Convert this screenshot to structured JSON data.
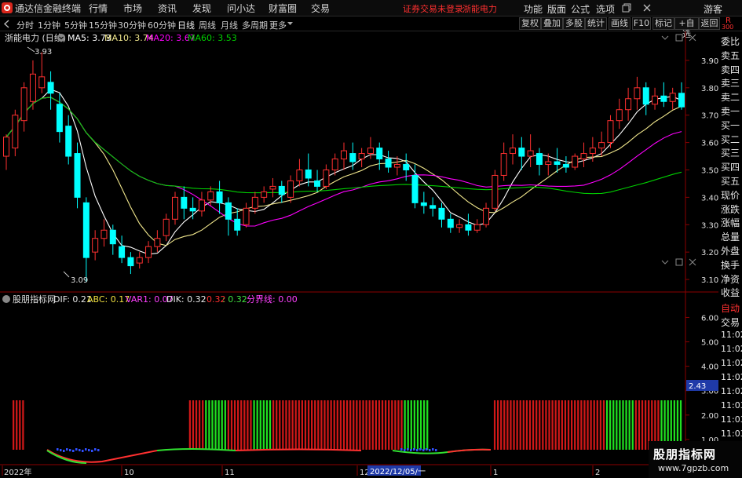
{
  "app": {
    "title": "通达信金融终端"
  },
  "menu": [
    {
      "label": "行情"
    },
    {
      "label": "市场"
    },
    {
      "label": "资讯"
    },
    {
      "label": "发现"
    },
    {
      "label": "问小达"
    },
    {
      "label": "财富圈"
    },
    {
      "label": "交易"
    }
  ],
  "status_text": "证券交易未登录",
  "stock_name": "浙能电力",
  "right_menu": [
    {
      "label": "功能"
    },
    {
      "label": "版面"
    },
    {
      "label": "公式"
    },
    {
      "label": "选项"
    }
  ],
  "guest_label": "游客",
  "periods": [
    {
      "label": "分时"
    },
    {
      "label": "1分钟"
    },
    {
      "label": "5分钟"
    },
    {
      "label": "15分钟"
    },
    {
      "label": "30分钟"
    },
    {
      "label": "60分钟"
    },
    {
      "label": "日线"
    },
    {
      "label": "周线"
    },
    {
      "label": "月线"
    },
    {
      "label": "多周期"
    },
    {
      "label": "更多"
    }
  ],
  "tool_buttons": [
    {
      "label": "复权"
    },
    {
      "label": "叠加"
    },
    {
      "label": "多股"
    },
    {
      "label": "统计"
    },
    {
      "label": "画线"
    },
    {
      "label": "F10"
    },
    {
      "label": "标记"
    },
    {
      "label": "+自选"
    },
    {
      "label": "返回"
    }
  ],
  "corner": {
    "top": "R",
    "bottom": "300"
  },
  "main_chart": {
    "title": "浙能电力 (日线)",
    "ma": [
      {
        "label": "MA5: 3.73",
        "color": "#ffffff"
      },
      {
        "label": "MA10: 3.74",
        "color": "#f0e68c"
      },
      {
        "label": "MA20: 3.67",
        "color": "#ff00ff"
      },
      {
        "label": "MA60: 3.53",
        "color": "#00d000"
      }
    ],
    "high_marker": "3.93",
    "low_marker": "3.09",
    "y_ticks": [
      "3.90",
      "3.80",
      "3.70",
      "3.60",
      "3.50",
      "3.40",
      "3.30",
      "3.20",
      "3.10"
    ]
  },
  "sub_chart": {
    "title": "股朋指标网",
    "items": [
      {
        "label": "DIF: 0.21",
        "color": "#e8e8e8"
      },
      {
        "label": "ABC: 0.17",
        "color": "#f0e040"
      },
      {
        "label": "VAR1: 0.07",
        "color": "#ff40ff"
      },
      {
        "label": "DIK: 0.32",
        "color": "#e8e8e8"
      },
      {
        "label": "0.32",
        "color": "#ff3030"
      },
      {
        "label": ": 0.32",
        "color": "#40e040"
      },
      {
        "label": "分界线: 0.00",
        "color": "#ff40ff"
      }
    ],
    "y_ticks": [
      "6.00",
      "5.00",
      "4.00",
      "3.00",
      "2.00",
      "1.00"
    ],
    "current_value": "2.43"
  },
  "x_axis": {
    "labels": [
      "2022年",
      "10",
      "11",
      "12",
      "1",
      "2"
    ],
    "cursor_label": "2022/12/05/一"
  },
  "right_panel": [
    {
      "label": "委比"
    },
    {
      "label": "卖五"
    },
    {
      "label": "卖四"
    },
    {
      "label": "卖三"
    },
    {
      "label": "卖二"
    },
    {
      "label": "卖一"
    },
    {
      "label": "买一"
    },
    {
      "label": "买二"
    },
    {
      "label": "买三"
    },
    {
      "label": "买四"
    },
    {
      "label": "买五"
    },
    {
      "label": "现价"
    },
    {
      "label": "涨跌"
    },
    {
      "label": "涨幅"
    },
    {
      "label": "总量"
    },
    {
      "label": "外盘"
    },
    {
      "label": "换手"
    },
    {
      "label": "净资"
    },
    {
      "label": "收益"
    },
    {
      "label": "自动"
    },
    {
      "label": "交易"
    },
    {
      "label": "11:02"
    },
    {
      "label": "11:02"
    },
    {
      "label": "11:02"
    },
    {
      "label": "11:02"
    },
    {
      "label": "11:02"
    },
    {
      "label": "11:03"
    },
    {
      "label": "11:03"
    },
    {
      "label": "11:03"
    },
    {
      "label": "11:03"
    },
    {
      "label": "11:03"
    },
    {
      "label": "11:03"
    },
    {
      "label": "11:03"
    }
  ],
  "watermark": {
    "line1": "股朋指标网",
    "line2": "www.7gpzb.com"
  },
  "colors": {
    "up": "#ff3030",
    "down": "#00ffff",
    "grid": "#8b0000",
    "ma5": "#ffffff",
    "ma10": "#f0e68c",
    "ma20": "#ff00ff",
    "ma60": "#00d000"
  },
  "chart_data": {
    "type": "candlestick",
    "title": "浙能电力 (日线)",
    "y_range": [
      3.06,
      3.96
    ],
    "candles": [
      [
        3.55,
        3.63,
        3.62,
        3.5
      ],
      [
        3.58,
        3.72,
        3.7,
        3.55
      ],
      [
        3.68,
        3.82,
        3.8,
        3.64
      ],
      [
        3.75,
        3.9,
        3.85,
        3.72
      ],
      [
        3.8,
        3.93,
        3.84,
        3.78
      ],
      [
        3.82,
        3.86,
        3.78,
        3.72
      ],
      [
        3.74,
        3.78,
        3.64,
        3.6
      ],
      [
        3.66,
        3.7,
        3.55,
        3.52
      ],
      [
        3.56,
        3.6,
        3.4,
        3.36
      ],
      [
        3.38,
        3.4,
        3.18,
        3.09
      ],
      [
        3.2,
        3.28,
        3.25,
        3.17
      ],
      [
        3.25,
        3.32,
        3.28,
        3.22
      ],
      [
        3.28,
        3.3,
        3.23,
        3.19
      ],
      [
        3.22,
        3.26,
        3.18,
        3.16
      ],
      [
        3.18,
        3.2,
        3.15,
        3.12
      ],
      [
        3.16,
        3.2,
        3.18,
        3.14
      ],
      [
        3.18,
        3.24,
        3.22,
        3.16
      ],
      [
        3.22,
        3.28,
        3.25,
        3.2
      ],
      [
        3.26,
        3.34,
        3.32,
        3.24
      ],
      [
        3.32,
        3.42,
        3.4,
        3.3
      ],
      [
        3.4,
        3.44,
        3.36,
        3.32
      ],
      [
        3.36,
        3.4,
        3.35,
        3.32
      ],
      [
        3.35,
        3.42,
        3.39,
        3.33
      ],
      [
        3.39,
        3.44,
        3.42,
        3.37
      ],
      [
        3.42,
        3.46,
        3.38,
        3.34
      ],
      [
        3.38,
        3.4,
        3.32,
        3.26
      ],
      [
        3.32,
        3.36,
        3.28,
        3.26
      ],
      [
        3.3,
        3.38,
        3.36,
        3.29
      ],
      [
        3.36,
        3.42,
        3.4,
        3.34
      ],
      [
        3.4,
        3.44,
        3.42,
        3.38
      ],
      [
        3.43,
        3.47,
        3.44,
        3.4
      ],
      [
        3.44,
        3.46,
        3.41,
        3.38
      ],
      [
        3.4,
        3.48,
        3.46,
        3.38
      ],
      [
        3.46,
        3.54,
        3.5,
        3.44
      ],
      [
        3.5,
        3.56,
        3.47,
        3.44
      ],
      [
        3.46,
        3.5,
        3.44,
        3.42
      ],
      [
        3.44,
        3.52,
        3.5,
        3.43
      ],
      [
        3.5,
        3.56,
        3.54,
        3.48
      ],
      [
        3.54,
        3.6,
        3.57,
        3.5
      ],
      [
        3.56,
        3.6,
        3.53,
        3.5
      ],
      [
        3.54,
        3.58,
        3.56,
        3.51
      ],
      [
        3.56,
        3.62,
        3.58,
        3.54
      ],
      [
        3.58,
        3.6,
        3.54,
        3.5
      ],
      [
        3.54,
        3.57,
        3.51,
        3.49
      ],
      [
        3.51,
        3.55,
        3.52,
        3.48
      ],
      [
        3.52,
        3.56,
        3.5,
        3.46
      ],
      [
        3.48,
        3.52,
        3.38,
        3.36
      ],
      [
        3.38,
        3.42,
        3.37,
        3.34
      ],
      [
        3.37,
        3.4,
        3.36,
        3.33
      ],
      [
        3.36,
        3.38,
        3.32,
        3.29
      ],
      [
        3.32,
        3.34,
        3.29,
        3.27
      ],
      [
        3.29,
        3.32,
        3.3,
        3.27
      ],
      [
        3.3,
        3.34,
        3.28,
        3.26
      ],
      [
        3.28,
        3.32,
        3.3,
        3.27
      ],
      [
        3.3,
        3.38,
        3.36,
        3.29
      ],
      [
        3.36,
        3.5,
        3.48,
        3.35
      ],
      [
        3.48,
        3.6,
        3.56,
        3.46
      ],
      [
        3.56,
        3.63,
        3.58,
        3.52
      ],
      [
        3.58,
        3.62,
        3.55,
        3.5
      ],
      [
        3.55,
        3.63,
        3.57,
        3.51
      ],
      [
        3.56,
        3.58,
        3.52,
        3.48
      ],
      [
        3.52,
        3.56,
        3.53,
        3.48
      ],
      [
        3.53,
        3.58,
        3.52,
        3.49
      ],
      [
        3.52,
        3.55,
        3.51,
        3.49
      ],
      [
        3.51,
        3.56,
        3.55,
        3.5
      ],
      [
        3.54,
        3.6,
        3.56,
        3.51
      ],
      [
        3.56,
        3.62,
        3.58,
        3.53
      ],
      [
        3.58,
        3.64,
        3.6,
        3.55
      ],
      [
        3.6,
        3.7,
        3.68,
        3.58
      ],
      [
        3.68,
        3.76,
        3.72,
        3.65
      ],
      [
        3.72,
        3.8,
        3.76,
        3.68
      ],
      [
        3.76,
        3.84,
        3.8,
        3.72
      ],
      [
        3.8,
        3.82,
        3.74,
        3.7
      ],
      [
        3.74,
        3.8,
        3.77,
        3.72
      ],
      [
        3.77,
        3.82,
        3.75,
        3.73
      ],
      [
        3.75,
        3.8,
        3.78,
        3.72
      ],
      [
        3.78,
        3.82,
        3.73,
        3.72
      ]
    ],
    "ma": {
      "MA5": 3.73,
      "MA10": 3.74,
      "MA20": 3.67,
      "MA60": 3.53
    },
    "indicator_bars": [
      1,
      1,
      1,
      1,
      0,
      0,
      0,
      0,
      0,
      0,
      0,
      0,
      0,
      0,
      0,
      0,
      0,
      0,
      0,
      0,
      0,
      0,
      0,
      0,
      0,
      0,
      0,
      0,
      0,
      0,
      0,
      0,
      0,
      0,
      0,
      0,
      0,
      0,
      0,
      0,
      0,
      0,
      0,
      0,
      0,
      0,
      0,
      0,
      0,
      0,
      0,
      0,
      0,
      0,
      0,
      1,
      1,
      1,
      1,
      1,
      2,
      2,
      2,
      2,
      2,
      2,
      2,
      1,
      1,
      1,
      1,
      1,
      1,
      1,
      1,
      2,
      2,
      2,
      2,
      2,
      2,
      1,
      1,
      1,
      1,
      1,
      1,
      1,
      1,
      1,
      1,
      1,
      1,
      1,
      1,
      1,
      1,
      1,
      1,
      1,
      1,
      1,
      1,
      1,
      1,
      1,
      1,
      1,
      1,
      1,
      1,
      1,
      1,
      1,
      1,
      1,
      1,
      1,
      1,
      1,
      1,
      1,
      2,
      2,
      2,
      2,
      2,
      2,
      2,
      2,
      0,
      0,
      0,
      0,
      0,
      0,
      0,
      0,
      0,
      0,
      0,
      0,
      0,
      0,
      0,
      0,
      0,
      0,
      0,
      0,
      1,
      1,
      1,
      1,
      1,
      1,
      1,
      1,
      1,
      1,
      1,
      1,
      1,
      1,
      1,
      1,
      1,
      1,
      1,
      1,
      1,
      1,
      1,
      1,
      1,
      1,
      1,
      1,
      1,
      1,
      1,
      1,
      1,
      1,
      1,
      2,
      2,
      2,
      2,
      2,
      2,
      2,
      2,
      2,
      1,
      1,
      1,
      1,
      1,
      1,
      1,
      1,
      2,
      2,
      2,
      2,
      2,
      2,
      2
    ]
  }
}
